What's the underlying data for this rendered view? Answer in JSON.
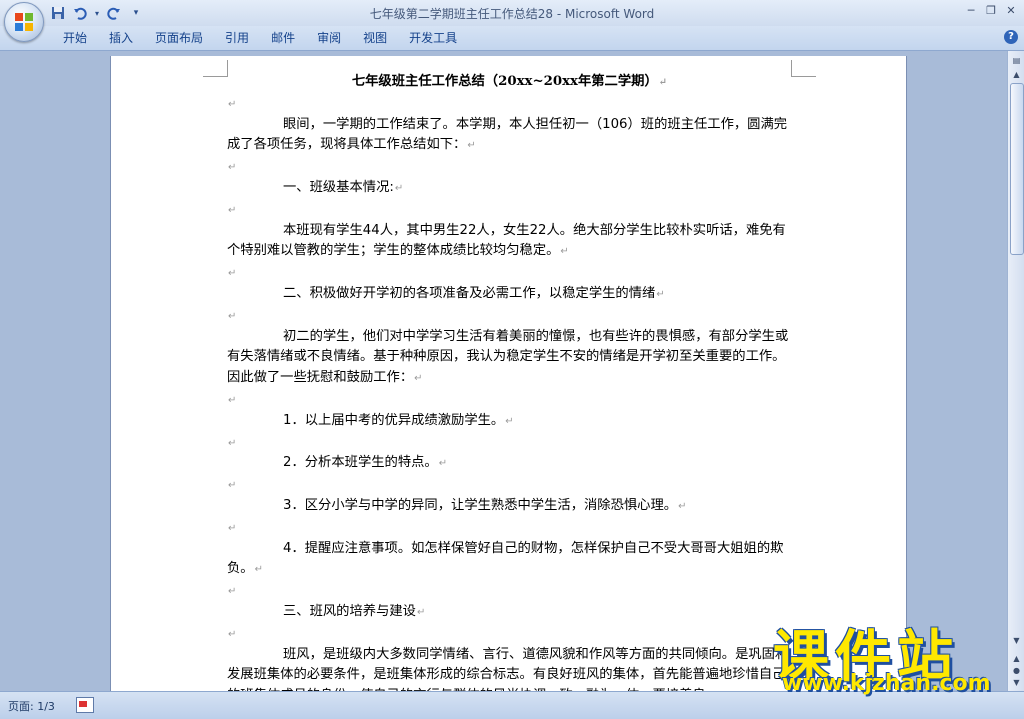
{
  "window": {
    "title": "七年级第二学期班主任工作总结28 - Microsoft Word"
  },
  "quick_access": [
    {
      "name": "save",
      "icon": "save-icon"
    },
    {
      "name": "undo",
      "icon": "undo-icon"
    },
    {
      "name": "redo",
      "icon": "redo-icon"
    },
    {
      "name": "customize",
      "icon": "chevron-down-icon"
    }
  ],
  "ribbon": {
    "tabs": [
      "开始",
      "插入",
      "页面布局",
      "引用",
      "邮件",
      "审阅",
      "视图",
      "开发工具"
    ]
  },
  "document": {
    "title": "七年级班主任工作总结（20xx~20xx年第二学期）",
    "paragraphs": [
      "眼间，一学期的工作结束了。本学期，本人担任初一（106）班的班主任工作，圆满完成了各项任务，现将具体工作总结如下：",
      "一、班级基本情况:",
      "本班现有学生44人，其中男生22人，女生22人。绝大部分学生比较朴实听话，难免有个特别难以管教的学生；学生的整体成绩比较均匀稳定。",
      "二、积极做好开学初的各项准备及必需工作，以稳定学生的情绪",
      "初二的学生，他们对中学学习生活有着美丽的憧憬，也有些许的畏惧感，有部分学生或有失落情绪或不良情绪。基于种种原因，我认为稳定学生不安的情绪是开学初至关重要的工作。因此做了一些抚慰和鼓励工作：",
      "1．以上届中考的优异成绩激励学生。",
      "2．分析本班学生的特点。",
      "3．区分小学与中学的异同，让学生熟悉中学生活，消除恐惧心理。",
      "4．提醒应注意事项。如怎样保管好自己的财物，怎样保护自己不受大哥哥大姐姐的欺负。",
      "三、班风的培养与建设",
      "班风，是班级内大多数同学情绪、言行、道德风貌和作风等方面的共同倾向。是巩固和发展班集体的必要条件，是班集体形成的综合标志。有良好班风的集体，首先能普遍地珍惜自己的班集体成员的身份，使自己的言行与群体的风尚协调一致，融为一体。要培养良"
    ]
  },
  "status": {
    "page": "页面: 1/3"
  },
  "watermark": {
    "text": "课件站",
    "url": "www.kjzhan.com"
  }
}
